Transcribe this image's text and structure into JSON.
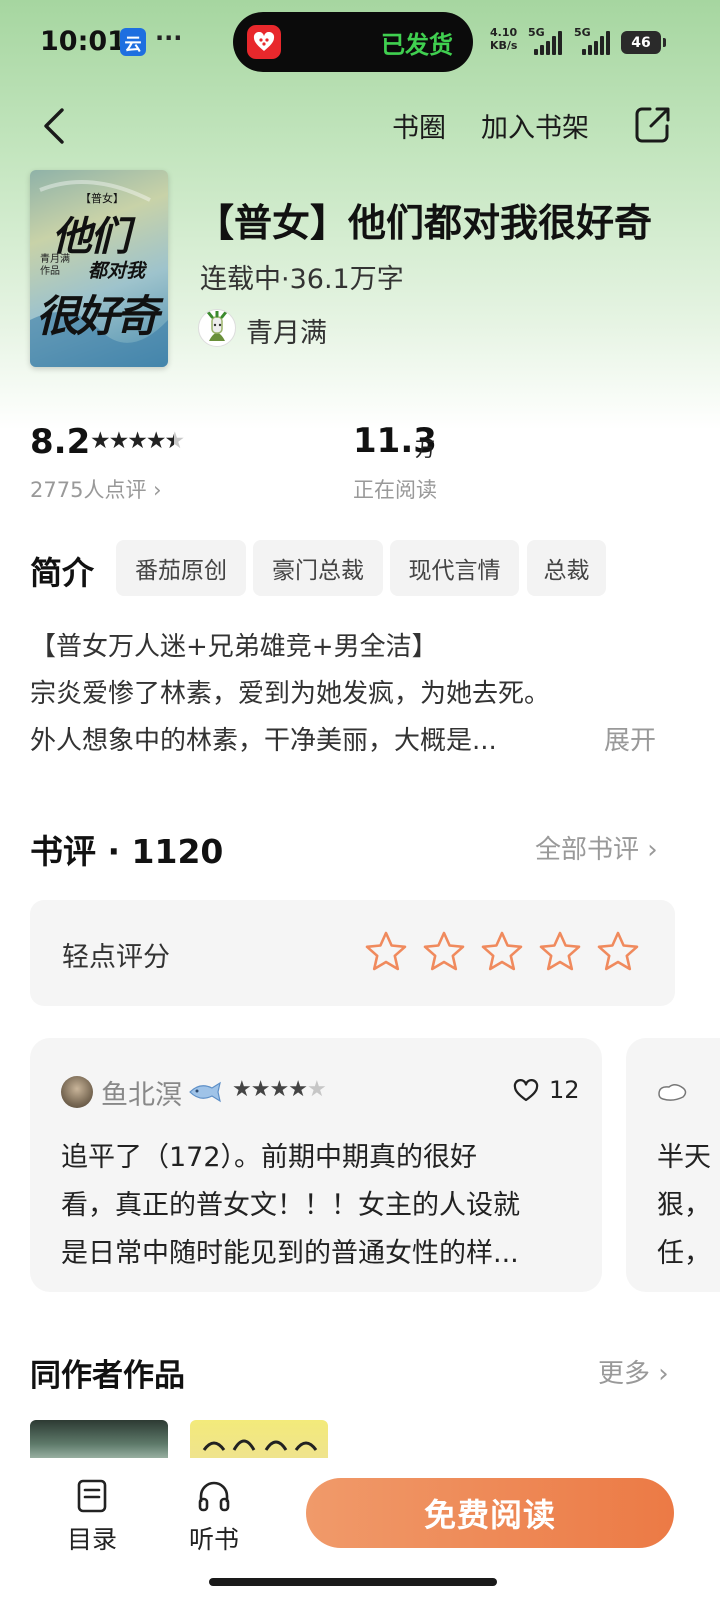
{
  "status_bar": {
    "time": "10:01",
    "app_badge": "云",
    "dots": "···",
    "notification": "已发货",
    "net_speed_value": "4.10",
    "net_speed_unit": "KB/s",
    "signal_1": "5G",
    "signal_2": "5G",
    "battery": "46"
  },
  "nav": {
    "circle": "书圈",
    "add_shelf": "加入书架"
  },
  "book": {
    "title": "【普女】他们都对我很好奇",
    "status_wordcount": "连载中·36.1万字",
    "author": "青月满",
    "cover": {
      "tag": "【普女】",
      "line1": "他们",
      "line2": "都对我",
      "author_line1": "青月满",
      "author_line2": "作品",
      "line3": "很好奇"
    }
  },
  "stats": {
    "score": "8.2",
    "rating_stars": 4.5,
    "review_count_label": "2775人点评",
    "readers_value": "11.3",
    "readers_unit": "万",
    "readers_label": "正在阅读"
  },
  "intro": {
    "heading": "简介",
    "tags": [
      "番茄原创",
      "豪门总裁",
      "现代言情",
      "总裁"
    ],
    "lines": [
      "【普女万人迷+兄弟雄竞+男全洁】",
      "宗炎爱惨了林素，爱到为她发疯，为她去死。",
      "外人想象中的林素，干净美丽，大概是..."
    ],
    "expand": "展开"
  },
  "reviews": {
    "heading": "书评",
    "separator": "·",
    "count": "1120",
    "all_link": "全部书评",
    "rate_label": "轻点评分",
    "rate_stars": 5,
    "items": [
      {
        "user": "鱼北溟",
        "stars": 4,
        "likes": "12",
        "lines": [
          "追平了（172）。前期中期真的很好",
          "看，真正的普女文！！！女主的人设就",
          "是日常中随时能见到的普通女性的样..."
        ]
      },
      {
        "user": "",
        "lines": [
          "半天",
          "狠，",
          "任，"
        ]
      }
    ]
  },
  "same_author": {
    "heading": "同作者作品",
    "more": "更多"
  },
  "bottom_bar": {
    "catalog": "目录",
    "listen": "听书",
    "read_free": "免费阅读"
  },
  "colors": {
    "accent": "#ec7a45",
    "header_green": "#a6d6a0",
    "star_orange": "#f08a5d"
  }
}
